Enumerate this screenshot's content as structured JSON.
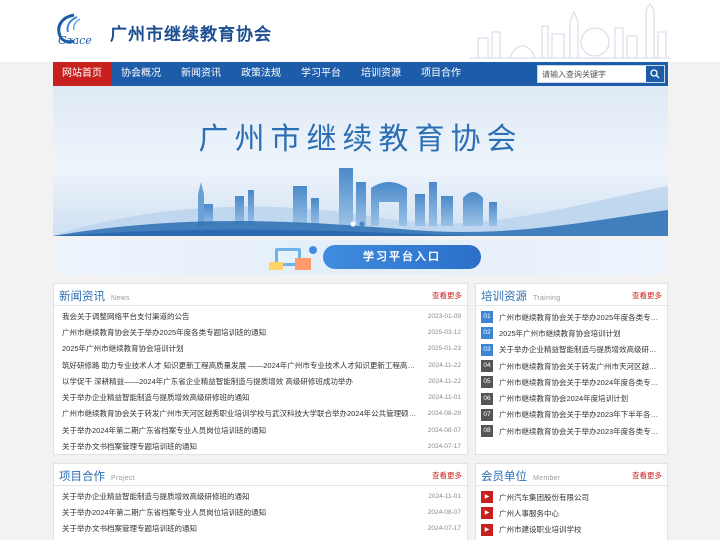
{
  "header": {
    "logo_text": "Gzace",
    "site_title": "广州市继续教育协会"
  },
  "nav": {
    "items": [
      "网站首页",
      "协会概况",
      "新闻资讯",
      "政策法规",
      "学习平台",
      "培训资源",
      "项目合作"
    ],
    "search_placeholder": "请输入查询关键字"
  },
  "banner": {
    "title": "广州市继续教育协会",
    "slide_count": 2,
    "active_slide": 2
  },
  "learn": {
    "label": "学习平台入口"
  },
  "news": {
    "title": "新闻资讯",
    "subtitle": "News",
    "more": "查看更多",
    "rows": [
      {
        "text": "我会关于调整网络平台支付渠道的公告",
        "date": "2023-01-09"
      },
      {
        "text": "广州市继续教育协会关于举办2025年度各类专题培训班的通知",
        "date": "2025-03-12"
      },
      {
        "text": "2025年广州市继续教育协会培训计划",
        "date": "2025-01-23"
      },
      {
        "text": "筑好研修路 助力专业技术人才 知识更新工程高质量发展 ——2024年广州市专业技术人才知识更新工程高端研修项...",
        "date": "2024-11-22"
      },
      {
        "text": "以学促干 深耕精益——2024年广东省企业精益智能制造与提质增效 高级研修班成功举办",
        "date": "2024-11-22"
      },
      {
        "text": "关于举办企业精益智能制造与提质增效高级研修班的通知",
        "date": "2024-11-01"
      },
      {
        "text": "广州市继续教育协会关于转发广州市天河区越秀职业培训学校与武汉科技大学联合举办2024年公共管理硕士研究生...",
        "date": "2024-08-28"
      },
      {
        "text": "关于举办2024年第二期广东省档案专业人员岗位培训班的通知",
        "date": "2024-08-07"
      },
      {
        "text": "关于举办文书档案管理专题培训班的通知",
        "date": "2024-07-17"
      }
    ]
  },
  "training": {
    "title": "培训资源",
    "subtitle": "Training",
    "more": "查看更多",
    "rows": [
      {
        "num": "01",
        "text": "广州市继续教育协会关于举办2025年度各类专题培..."
      },
      {
        "num": "02",
        "text": "2025年广州市继续教育协会培训计划"
      },
      {
        "num": "03",
        "text": "关于举办企业精益智能制造与提质增效高级研修班..."
      },
      {
        "num": "04",
        "text": "广州市继续教育协会关于转发广州市天河区越秀职..."
      },
      {
        "num": "05",
        "text": "广州市继续教育协会关于举办2024年度各类专题培..."
      },
      {
        "num": "06",
        "text": "广州市继续教育协会2024年度培训计划"
      },
      {
        "num": "07",
        "text": "广州市继续教育协会关于举办2023年下半年各类专..."
      },
      {
        "num": "08",
        "text": "广州市继续教育协会关于举办2023年度各类专题培训..."
      }
    ]
  },
  "projects": {
    "title": "项目合作",
    "subtitle": "Project",
    "more": "查看更多",
    "rows": [
      {
        "text": "关于举办企业精益智能制造与提质增效高级研修班的通知",
        "date": "2024-11-01"
      },
      {
        "text": "关于举办2024年第二期广东省档案专业人员岗位培训班的通知",
        "date": "2024-08-07"
      },
      {
        "text": "关于举办文书档案管理专题培训班的通知",
        "date": "2024-07-17"
      }
    ]
  },
  "members": {
    "title": "会员单位",
    "subtitle": "Member",
    "more": "查看更多",
    "rows": [
      {
        "text": "广州汽车集团股份有限公司"
      },
      {
        "text": "广州人事服务中心"
      },
      {
        "text": "广州市建设职业培训学校"
      }
    ]
  },
  "colors": {
    "nav_blue": "#1d5ca8",
    "active_red": "#c8201f",
    "title_blue": "#1e4f92"
  }
}
